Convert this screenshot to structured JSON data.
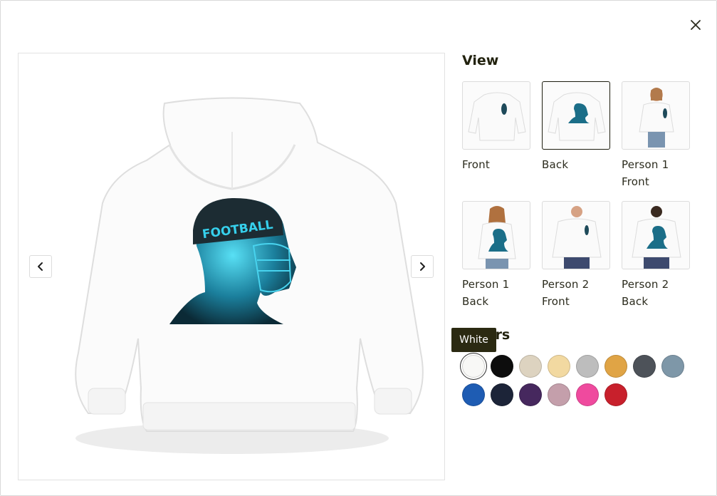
{
  "view": {
    "title": "View",
    "thumbnails": [
      {
        "label": "Front",
        "selected": false
      },
      {
        "label": "Back",
        "selected": true
      },
      {
        "label": "Person 1 Front",
        "selected": false
      },
      {
        "label": "Person 1 Back",
        "selected": false
      },
      {
        "label": "Person 2 Front",
        "selected": false
      },
      {
        "label": "Person 2 Back",
        "selected": false
      }
    ]
  },
  "colors": {
    "title": "Colors",
    "tooltip": "White",
    "swatches": [
      {
        "name": "White",
        "hex": "#f8f8f6",
        "selected": true
      },
      {
        "name": "Black",
        "hex": "#0d0d0d"
      },
      {
        "name": "Sand",
        "hex": "#ddd3c0"
      },
      {
        "name": "Cream",
        "hex": "#f2d9a1"
      },
      {
        "name": "Heather Grey",
        "hex": "#bdbdbd"
      },
      {
        "name": "Gold",
        "hex": "#e0a445"
      },
      {
        "name": "Charcoal Heather",
        "hex": "#4d5259"
      },
      {
        "name": "Slate Blue",
        "hex": "#7e97a8"
      },
      {
        "name": "Royal Blue",
        "hex": "#1e5cb3"
      },
      {
        "name": "Navy",
        "hex": "#1c2438"
      },
      {
        "name": "Purple",
        "hex": "#46285e"
      },
      {
        "name": "Mauve",
        "hex": "#c49fab"
      },
      {
        "name": "Pink",
        "hex": "#ef4a9e"
      },
      {
        "name": "Red",
        "hex": "#c8202c"
      }
    ]
  },
  "product_image": {
    "print_text": "FOOTBALL",
    "garment_color": "#fafafa",
    "print_color": "#2ec3e0"
  },
  "icons": {
    "close": "close-icon",
    "prev": "chevron-left-icon",
    "next": "chevron-right-icon"
  }
}
